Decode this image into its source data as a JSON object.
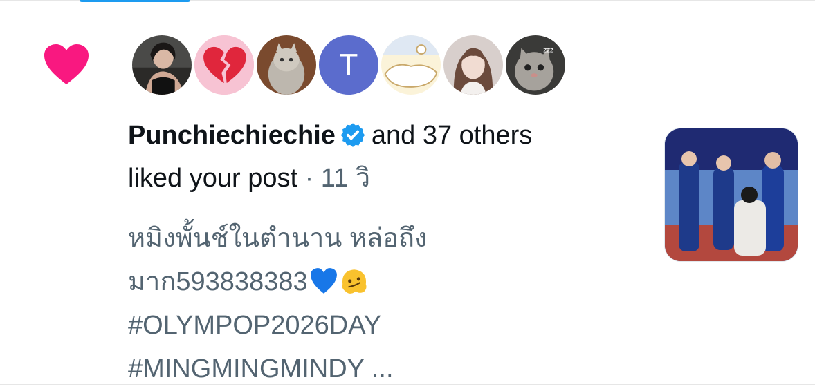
{
  "notification": {
    "type_icon": "heart-icon",
    "heart_color": "#f91880",
    "liker_avatars": [
      {
        "kind": "photo",
        "label": "user-avatar-1"
      },
      {
        "kind": "emoji",
        "label": "broken-heart-avatar"
      },
      {
        "kind": "photo",
        "label": "cat-avatar"
      },
      {
        "kind": "letter",
        "letter": "T",
        "color": "#5b6ccd"
      },
      {
        "kind": "illustration",
        "label": "cartoon-avatar"
      },
      {
        "kind": "photo",
        "label": "user-avatar-2"
      },
      {
        "kind": "photo",
        "label": "kitten-avatar"
      }
    ],
    "primary_user": "Punchiechiechie",
    "verified": true,
    "verified_color": "#1d9bf0",
    "others_text": "and 37 others",
    "action_text": "liked your post",
    "separator": "·",
    "time": "11 วิ",
    "post_lines": [
      "หมิงพั้นช์ในตำนาน หล่อถึง",
      "มาก593838383",
      "#OLYMPOP2026DAY",
      "#MINGMINGMINDY ..."
    ],
    "post_emojis": [
      "blue-heart-emoji",
      "melting-face-emoji"
    ],
    "thumbnail_label": "post-media-thumbnail"
  }
}
